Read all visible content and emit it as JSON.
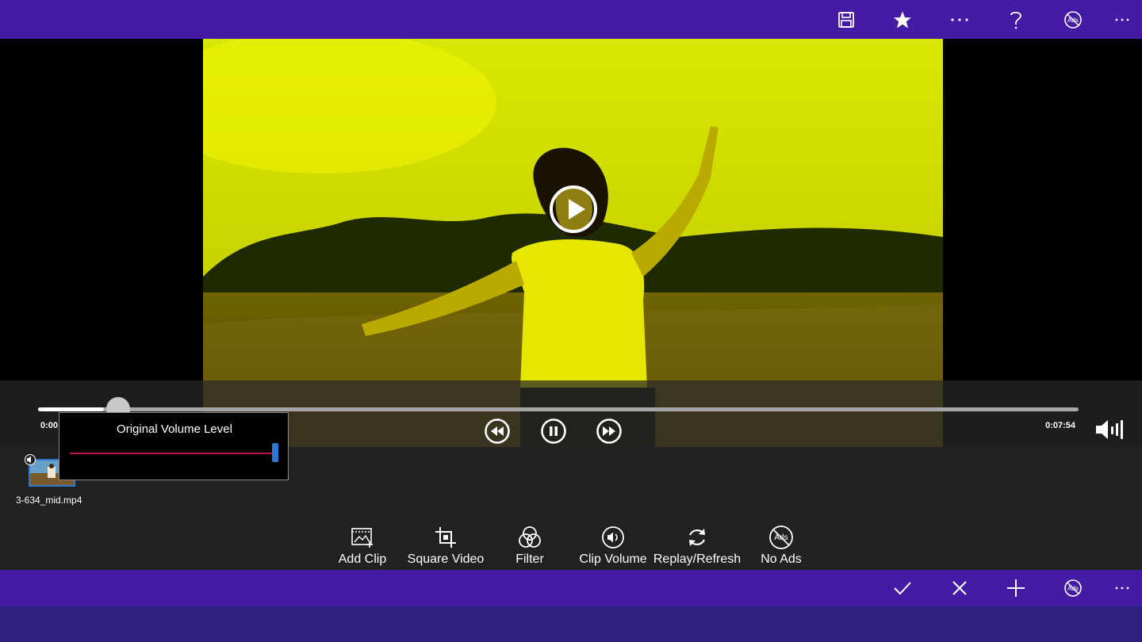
{
  "topbar": {
    "buttons": [
      {
        "name": "save-button",
        "icon": "save-icon"
      },
      {
        "name": "favorite-button",
        "icon": "star-icon"
      },
      {
        "name": "more-menu-button",
        "icon": "more-icon"
      },
      {
        "name": "help-button",
        "icon": "help-icon"
      },
      {
        "name": "no-ads-button",
        "icon": "no-ads-icon",
        "badge": "Ads"
      },
      {
        "name": "overflow-button",
        "icon": "more-icon"
      }
    ]
  },
  "player": {
    "current_time": "0:00",
    "total_time": "0:07:54",
    "progress_fraction": 0.063,
    "controls": {
      "rewind": "rewind-icon",
      "pause": "pause-icon",
      "fast_forward": "fast-forward-icon",
      "play_overlay": "play-icon",
      "volume": "volume-icon"
    }
  },
  "volume_popup": {
    "title": "Original Volume Level",
    "level_fraction": 1.0
  },
  "timeline": {
    "clips": [
      {
        "filename": "3-634_mid.mp4"
      }
    ]
  },
  "toolbar": {
    "items": [
      {
        "label": "Add Clip",
        "icon": "add-clip-icon"
      },
      {
        "label": "Square Video",
        "icon": "crop-icon"
      },
      {
        "label": "Filter",
        "icon": "filter-icon"
      },
      {
        "label": "Clip Volume",
        "icon": "volume-icon"
      },
      {
        "label": "Replay/Refresh",
        "icon": "refresh-icon"
      },
      {
        "label": "No Ads",
        "icon": "no-ads-icon",
        "badge": "Ads"
      }
    ]
  },
  "bottombar": {
    "buttons": [
      {
        "name": "confirm-button",
        "icon": "check-icon"
      },
      {
        "name": "cancel-button",
        "icon": "close-icon"
      },
      {
        "name": "add-button",
        "icon": "plus-icon"
      },
      {
        "name": "no-ads-button",
        "icon": "no-ads-icon",
        "badge": "Ads"
      },
      {
        "name": "overflow-button",
        "icon": "more-icon"
      }
    ]
  },
  "colors": {
    "app_bar": "#431ba5",
    "bottom_strip": "#2f1f7e",
    "panel": "#212121",
    "volume_track": "#c0124a",
    "accent_blue": "#2a7bd7"
  }
}
